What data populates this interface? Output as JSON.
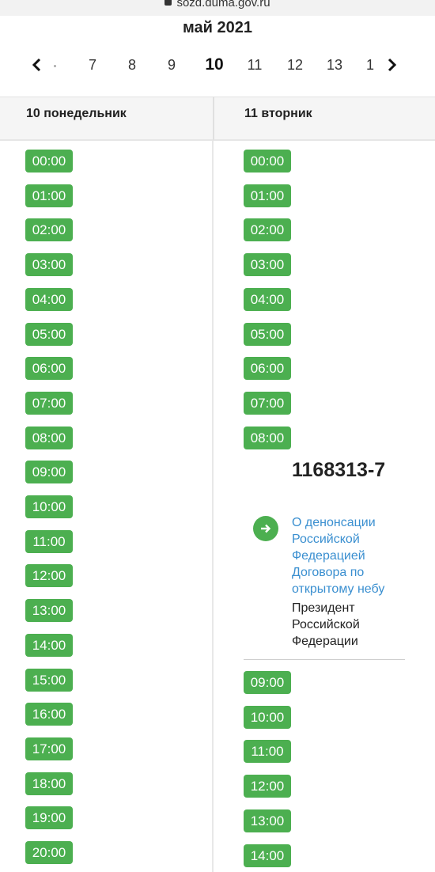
{
  "browser": {
    "url": "sozd.duma.gov.ru"
  },
  "calendar": {
    "month_title": "май 2021",
    "prev_icon": "chevron-left-icon",
    "next_icon": "chevron-right-icon",
    "days": [
      "7",
      "8",
      "9",
      "10",
      "11",
      "12",
      "13",
      "1"
    ],
    "active_day": "10"
  },
  "columns": {
    "left": {
      "header": "10 понедельник",
      "times": [
        "00:00",
        "01:00",
        "02:00",
        "03:00",
        "04:00",
        "05:00",
        "06:00",
        "07:00",
        "08:00",
        "09:00",
        "10:00",
        "11:00",
        "12:00",
        "13:00",
        "14:00",
        "15:00",
        "16:00",
        "17:00",
        "18:00",
        "19:00",
        "20:00"
      ]
    },
    "right": {
      "header": "11 вторник",
      "times_before": [
        "00:00",
        "01:00",
        "02:00",
        "03:00",
        "04:00",
        "05:00",
        "06:00",
        "07:00",
        "08:00"
      ],
      "event": {
        "number": "1168313-7",
        "title": "О денонсации Российской Федерацией Договора по открытому небу",
        "author": "Президент Российской Федерации",
        "icon": "arrow-right-icon"
      },
      "times_after": [
        "09:00",
        "10:00",
        "11:00",
        "12:00",
        "13:00",
        "14:00"
      ]
    }
  },
  "colors": {
    "badge": "#4caf50",
    "link": "#3a8fd0",
    "header_bg": "#f5f5f5"
  }
}
